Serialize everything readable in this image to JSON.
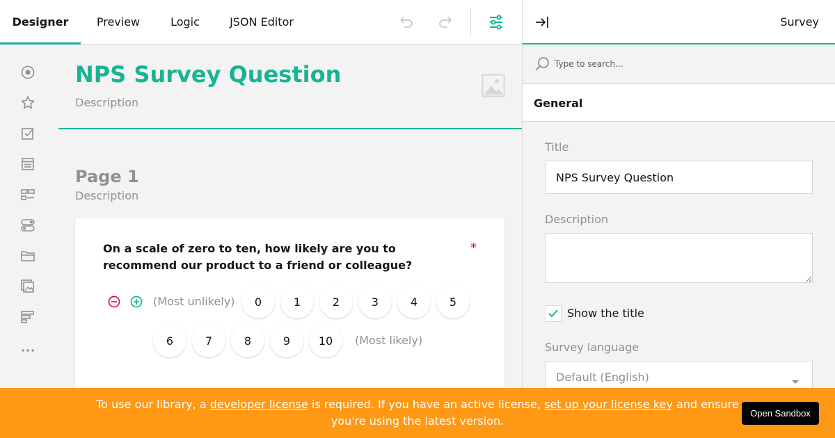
{
  "header": {
    "tabs": [
      {
        "label": "Designer",
        "active": true
      },
      {
        "label": "Preview",
        "active": false
      },
      {
        "label": "Logic",
        "active": false
      },
      {
        "label": "JSON Editor",
        "active": false
      }
    ],
    "icons": [
      "undo-icon",
      "redo-icon",
      "settings-sliders-icon"
    ]
  },
  "toolbox": {
    "icons": [
      "radiogroup-icon",
      "rating-icon",
      "checkbox-icon",
      "dropdown-icon",
      "tagbox-icon",
      "boolean-icon",
      "file-icon",
      "imagepicker-icon",
      "ranking-icon",
      "more-icon"
    ]
  },
  "survey": {
    "title": "NPS Survey Question",
    "description": "Description",
    "page": {
      "title": "Page 1",
      "description": "Description"
    },
    "question": {
      "title": "On a scale of zero to ten, how likely are you to recommend our product to a friend or colleague?",
      "required_mark": "*",
      "min_label": "(Most unlikely)",
      "max_label": "(Most likely)",
      "row1": [
        "0",
        "1",
        "2",
        "3",
        "4",
        "5"
      ],
      "row2": [
        "6",
        "7",
        "8",
        "9",
        "10"
      ]
    }
  },
  "properties": {
    "object_name": "Survey",
    "search_placeholder": "Type to search...",
    "section_title": "General",
    "title_label": "Title",
    "title_value": "NPS Survey Question",
    "description_label": "Description",
    "description_value": "",
    "show_title_label": "Show the title",
    "show_title_checked": true,
    "language_label": "Survey language",
    "language_value": "Default (English)"
  },
  "banner": {
    "text_before": "To use our library, a ",
    "link1": "developer license",
    "text_middle": " is required. If you have an active license, ",
    "link2": "set up your license key",
    "text_after": " and ensure you're using the latest version.",
    "button_label": "Open Sandbox"
  },
  "colors": {
    "accent": "#19b394",
    "banner": "#ff9814",
    "required": "#e50a3e",
    "remove": "#e50a3e"
  }
}
